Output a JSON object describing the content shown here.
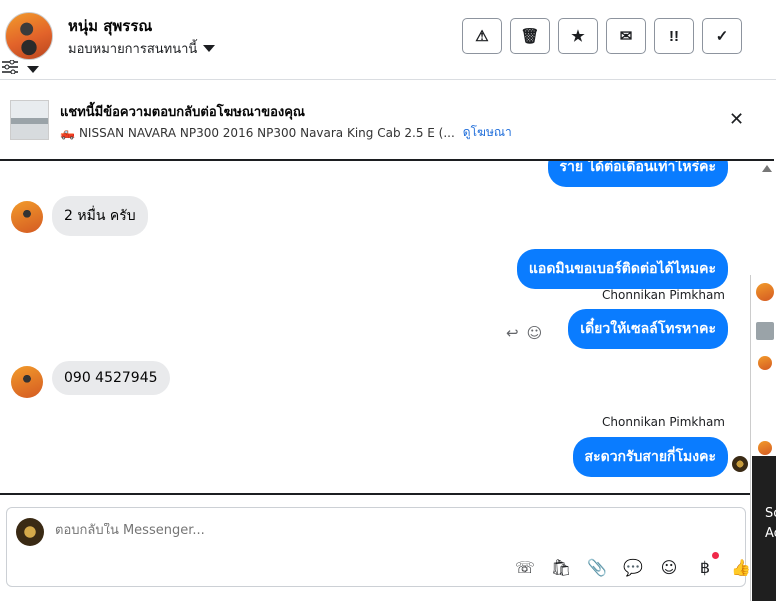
{
  "header": {
    "contact_name": "หนุ่ม สุพรรณ",
    "assign_label": "มอบหมายการสนทนานี้",
    "actions": [
      {
        "icon": "warning-icon",
        "glyph": "⚠"
      },
      {
        "icon": "trash-icon",
        "glyph": "🗑"
      },
      {
        "icon": "star-icon",
        "glyph": "★"
      },
      {
        "icon": "mail-icon",
        "glyph": "✉"
      },
      {
        "icon": "follow-up-icon",
        "glyph": "!!"
      },
      {
        "icon": "check-icon",
        "glyph": "✓"
      }
    ]
  },
  "ad_banner": {
    "title": "แชทนี้มีข้อความตอบกลับต่อโฆษณาของคุณ",
    "description": "NISSAN NAVARA NP300 2016 NP300 Navara King Cab 2.5 E (...",
    "link": "ดูโฆษณา",
    "close": "✕"
  },
  "messages": {
    "partial_top": "ราย ได้ต่อเดือนเท่าไหร่คะ",
    "in_1": "2 หมื่น ครับ",
    "out_1": "แอดมินขอเบอร์ติดต่อได้ไหมคะ",
    "sender_1": "Chonnikan Pimkham",
    "out_2": "เดี๋ยวให้เซลล์โทรหาคะ",
    "in_2": "090 4527945",
    "sender_2": "Chonnikan Pimkham",
    "out_3": "สะดวกรับสายกี่โมงคะ"
  },
  "reply_icons": {
    "reply": "↩",
    "react": "☺"
  },
  "side": {
    "text_1": "Sc",
    "text_2": "Ac"
  },
  "composer": {
    "placeholder": "ตอบกลับใน Messenger...",
    "tools": [
      {
        "icon": "call-icon",
        "glyph": "☏"
      },
      {
        "icon": "bag-icon",
        "glyph": "🛍"
      },
      {
        "icon": "attachment-icon",
        "glyph": "📎"
      },
      {
        "icon": "saved-reply-icon",
        "glyph": "💬"
      },
      {
        "icon": "emoji-icon",
        "glyph": "☺"
      },
      {
        "icon": "baht-icon",
        "glyph": "฿"
      },
      {
        "icon": "thumbs-up-icon",
        "glyph": "👍"
      }
    ]
  }
}
